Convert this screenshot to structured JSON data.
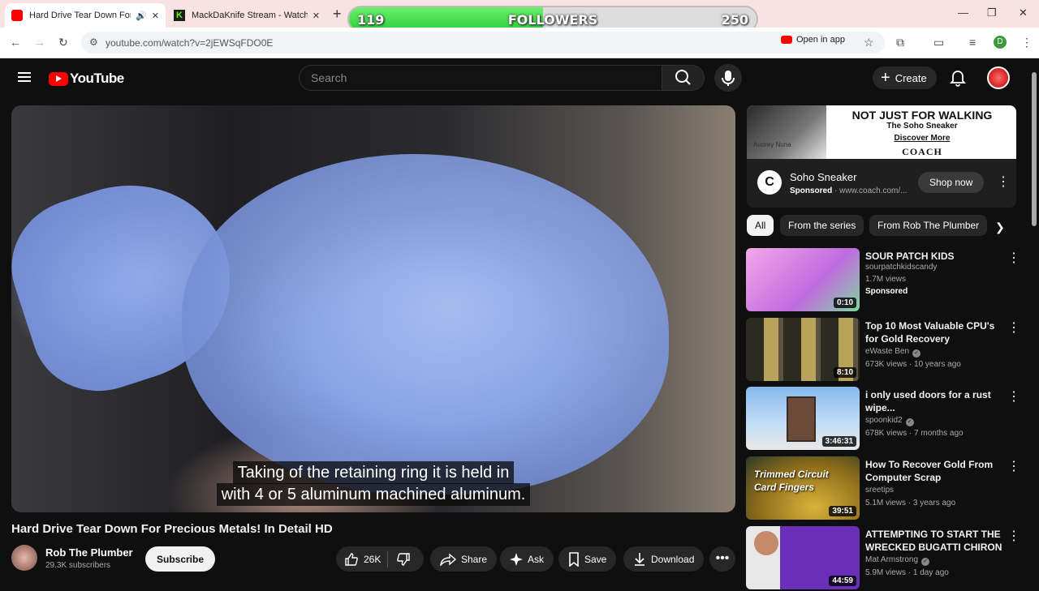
{
  "browser": {
    "tabs": [
      {
        "title": "Hard Drive Tear Down For P",
        "active": true
      },
      {
        "title": "MackDaKnife Stream - Watch L",
        "active": false
      }
    ],
    "url": "youtube.com/watch?v=2jEWSqFDO0E",
    "open_in_app": "Open in app",
    "profile_initial": "D"
  },
  "overlay": {
    "current": "119",
    "label": "FOLLOWERS",
    "goal": "250",
    "progress_fraction": 0.476
  },
  "header": {
    "logo": "YouTube",
    "search_placeholder": "Search",
    "create_label": "Create"
  },
  "video": {
    "caption_lines": [
      "Taking of the retaining ring it is held in",
      "with 4 or 5 aluminum machined aluminum."
    ],
    "title": "Hard Drive Tear Down For Precious Metals! In Detail HD",
    "channel": "Rob The Plumber",
    "subscribers": "29.3K subscribers",
    "subscribe_label": "Subscribe",
    "likes": "26K",
    "share_label": "Share",
    "ask_label": "Ask",
    "save_label": "Save",
    "download_label": "Download"
  },
  "ad": {
    "headline": "NOT JUST FOR WALKING",
    "line1": "The Soho Sneaker",
    "line2": "Discover More",
    "brand": "COACH",
    "photo_caption": "Audrey Nuna",
    "name": "Soho Sneaker",
    "sponsored": "Sponsored",
    "domain": "www.coach.com/...",
    "cta": "Shop now"
  },
  "chips": [
    "All",
    "From the series",
    "From Rob The Plumber"
  ],
  "recommendations": [
    {
      "title": "SOUR PATCH KIDS",
      "channel": "sourpatchkidscandy",
      "views": "1.7M views",
      "sponsored": "Sponsored",
      "duration": "0:10",
      "verified": false
    },
    {
      "title": "Top 10 Most Valuable CPU's for Gold Recovery",
      "channel": "eWaste Ben",
      "views": "673K views · 10 years ago",
      "duration": "8:10",
      "verified": true
    },
    {
      "title": "i only used doors for a rust wipe...",
      "channel": "spoonkid2",
      "views": "678K views · 7 months ago",
      "duration": "3:46:31",
      "verified": true
    },
    {
      "title": "How To Recover Gold From Computer Scrap",
      "channel": "sreetips",
      "views": "5.1M views · 3 years ago",
      "duration": "39:51",
      "verified": false,
      "thumb_text": "Trimmed Circuit Card Fingers"
    },
    {
      "title": "ATTEMPTING TO START THE WRECKED BUGATTI CHIRON ...",
      "channel": "Mat Armstrong",
      "views": "5.9M views · 1 day ago",
      "duration": "44:59",
      "verified": true
    }
  ]
}
